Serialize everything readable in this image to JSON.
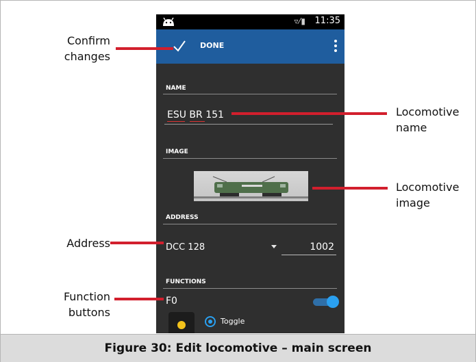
{
  "statusbar": {
    "icons": "▿⁄▮",
    "time": "11:35"
  },
  "actionbar": {
    "done_label": "DONE"
  },
  "sections": {
    "name": {
      "label": "NAME",
      "value": "ESU BR 151"
    },
    "image": {
      "label": "IMAGE"
    },
    "address": {
      "label": "ADDRESS",
      "protocol": "DCC 128",
      "number": "1002"
    },
    "functions": {
      "label": "FUNCTIONS",
      "first": "F0",
      "toggle_label": "Toggle",
      "toggle_on": true
    }
  },
  "callouts": {
    "confirm": [
      "Confirm",
      "changes"
    ],
    "loco_name": [
      "Locomotive",
      "name"
    ],
    "loco_image": [
      "Locomotive",
      "image"
    ],
    "address": [
      "Address"
    ],
    "function": [
      "Function",
      "buttons"
    ]
  },
  "caption": "Figure 30: Edit locomotive – main screen",
  "colors": {
    "action_bar": "#1f5d9e",
    "pointer": "#d21f2d",
    "toggle": "#2aa0f0",
    "function_button": "#f2c21b"
  }
}
